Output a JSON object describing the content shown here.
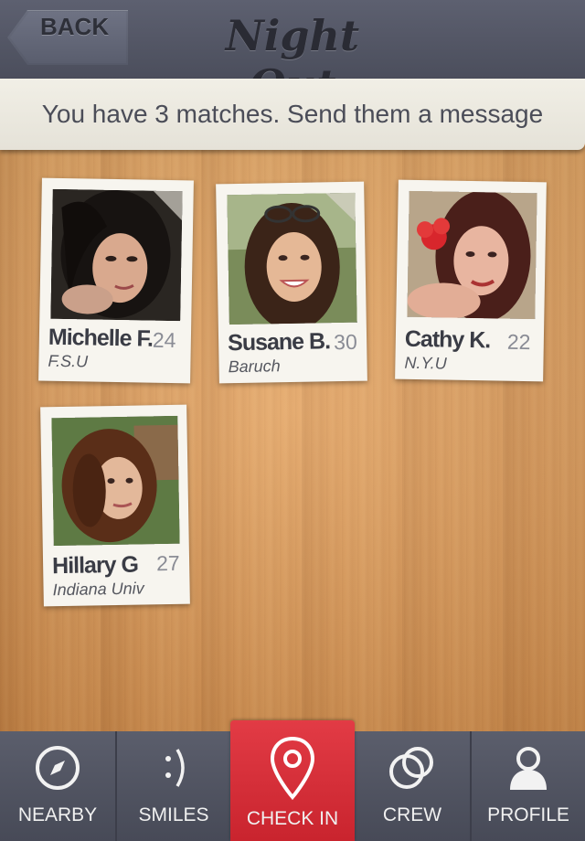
{
  "header": {
    "back_label": "BACK",
    "title": "Night Out"
  },
  "banner": {
    "text": "You have 3 matches. Send them a message"
  },
  "matches": [
    {
      "name": "Michelle F.",
      "age": "24",
      "school": "F.S.U"
    },
    {
      "name": "Susane B.",
      "age": "30",
      "school": "Baruch"
    },
    {
      "name": "Cathy K.",
      "age": "22",
      "school": "N.Y.U"
    },
    {
      "name": "Hillary G",
      "age": "27",
      "school": "Indiana Univ"
    }
  ],
  "tabs": [
    {
      "label": "NEARBY",
      "icon": "compass-icon"
    },
    {
      "label": "SMILES",
      "icon": "smiley-icon"
    },
    {
      "label": "CHECK IN",
      "icon": "map-pin-icon",
      "active": true
    },
    {
      "label": "CREW",
      "icon": "rings-icon"
    },
    {
      "label": "PROFILE",
      "icon": "user-icon"
    }
  ],
  "colors": {
    "header": "#4b4e5c",
    "active_tab": "#d62f39",
    "banner": "#ece9e0",
    "wood": "#e1a060"
  }
}
